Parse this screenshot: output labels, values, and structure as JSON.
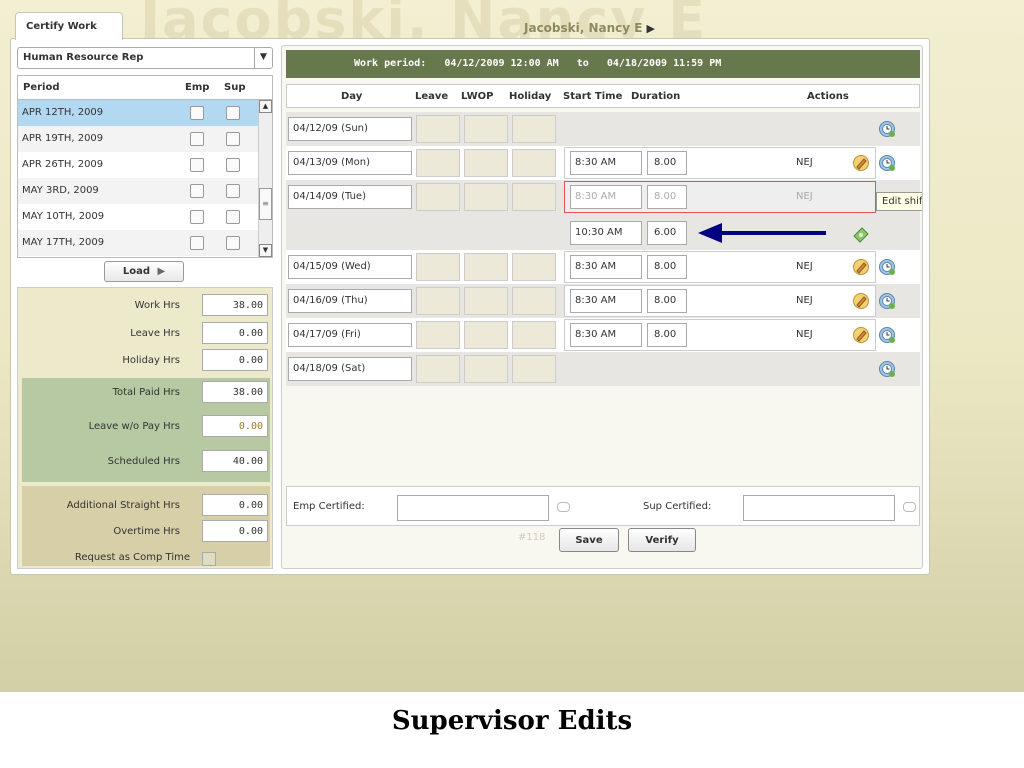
{
  "header": {
    "watermark": "Jacobski, Nancy E",
    "tab_label": "Certify Work",
    "user_name": "Jacobski, Nancy E",
    "user_arrow": "▶"
  },
  "left": {
    "role": "Human Resource Rep",
    "role_dropdown_glyph": "▼",
    "columns": [
      "Period",
      "Emp",
      "Sup"
    ],
    "periods": [
      "APR 12TH, 2009",
      "APR 19TH, 2009",
      "APR 26TH, 2009",
      "MAY 3RD, 2009",
      "MAY 10TH, 2009",
      "MAY 17TH, 2009"
    ],
    "selected_period_index": 0,
    "load_label": "Load",
    "load_glyph": "▶"
  },
  "summary": {
    "work_hrs_label": "Work Hrs",
    "work_hrs": "38.00",
    "leave_hrs_label": "Leave Hrs",
    "leave_hrs": "0.00",
    "holiday_hrs_label": "Holiday Hrs",
    "holiday_hrs": "0.00",
    "total_paid_label": "Total Paid Hrs",
    "total_paid": "38.00",
    "leave_wo_pay_label": "Leave w/o Pay Hrs",
    "leave_wo_pay": "0.00",
    "scheduled_label": "Scheduled Hrs",
    "scheduled": "40.00",
    "additional_label": "Additional Straight Hrs",
    "additional": "0.00",
    "overtime_label": "Overtime Hrs",
    "overtime": "0.00",
    "comp_time_label": "Request as Comp Time"
  },
  "work_period": {
    "label": "Work period:",
    "start": "04/12/2009 12:00 AM",
    "to": "to",
    "end": "04/18/2009 11:59 PM"
  },
  "grid_headers": {
    "day": "Day",
    "leave": "Leave",
    "lwop": "LWOP",
    "holiday": "Holiday",
    "start_time": "Start Time",
    "duration": "Duration",
    "actions": "Actions"
  },
  "days": {
    "sun": "04/12/09 (Sun)",
    "mon": "04/13/09 (Mon)",
    "tue": "04/14/09 (Tue)",
    "wed": "04/15/09 (Wed)",
    "thu": "04/16/09 (Thu)",
    "fri": "04/17/09 (Fri)",
    "sat": "04/18/09 (Sat)"
  },
  "shifts": {
    "mon": {
      "start": "8:30 AM",
      "duration": "8.00",
      "code": "NEJ"
    },
    "tue": {
      "start": "8:30 AM",
      "duration": "8.00",
      "code": "NEJ"
    },
    "tue_new": {
      "start": "10:30 AM",
      "duration": "6.00"
    },
    "wed": {
      "start": "8:30 AM",
      "duration": "8.00",
      "code": "NEJ"
    },
    "thu": {
      "start": "8:30 AM",
      "duration": "8.00",
      "code": "NEJ"
    },
    "fri": {
      "start": "8:30 AM",
      "duration": "8.00",
      "code": "NEJ"
    }
  },
  "tooltip": "Edit shift",
  "footer": {
    "emp_certified_label": "Emp Certified:",
    "sup_certified_label": "Sup Certified:",
    "rev": "#118",
    "save_label": "Save",
    "verify_label": "Verify"
  },
  "caption": "Supervisor Edits",
  "colors": {
    "work_period_bar": "#66784c",
    "selected_row": "#b3d9f2",
    "arrow": "#000080",
    "edit_border": "#e05555",
    "summary_green": "#b6c9a2",
    "summary_tan": "#d7cfa7"
  }
}
